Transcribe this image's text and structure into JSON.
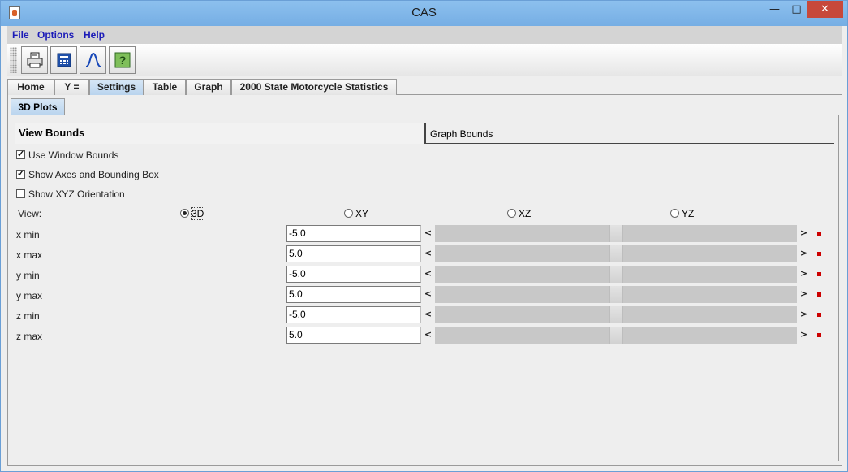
{
  "window": {
    "title": "CAS"
  },
  "window_controls": {
    "minimize": "—",
    "maximize": "□",
    "close": "✕"
  },
  "menu": [
    "File",
    "Options",
    "Help"
  ],
  "toolbar": [
    "print-icon",
    "calculator-icon",
    "graph-curve-icon",
    "help-icon"
  ],
  "tabs": [
    "Home",
    "Y =",
    "Settings",
    "Table",
    "Graph",
    "2000 State Motorcycle Statistics"
  ],
  "selected_tab": "Settings",
  "subtabs": [
    "3D Plots"
  ],
  "sections": {
    "view_bounds": "View Bounds",
    "graph_bounds": "Graph Bounds"
  },
  "checkboxes": [
    {
      "label": "Use Window Bounds",
      "checked": true
    },
    {
      "label": "Show Axes and Bounding Box",
      "checked": true
    },
    {
      "label": "Show XYZ Orientation",
      "checked": false
    }
  ],
  "view": {
    "label": "View:",
    "options": [
      "3D",
      "XY",
      "XZ",
      "YZ"
    ],
    "selected": "3D"
  },
  "bounds": [
    {
      "label": "x min",
      "value": "-5.0"
    },
    {
      "label": "x max",
      "value": "5.0"
    },
    {
      "label": "y min",
      "value": "-5.0"
    },
    {
      "label": "y max",
      "value": "5.0"
    },
    {
      "label": "z min",
      "value": "-5.0"
    },
    {
      "label": "z max",
      "value": "5.0"
    }
  ],
  "slider_position": 0.5,
  "scroll_arrows": {
    "left": "<",
    "right": ">"
  },
  "colors": {
    "accent": "#b9d4ee",
    "menu_text": "#1b1bb8",
    "indicator": "#cc0000"
  }
}
